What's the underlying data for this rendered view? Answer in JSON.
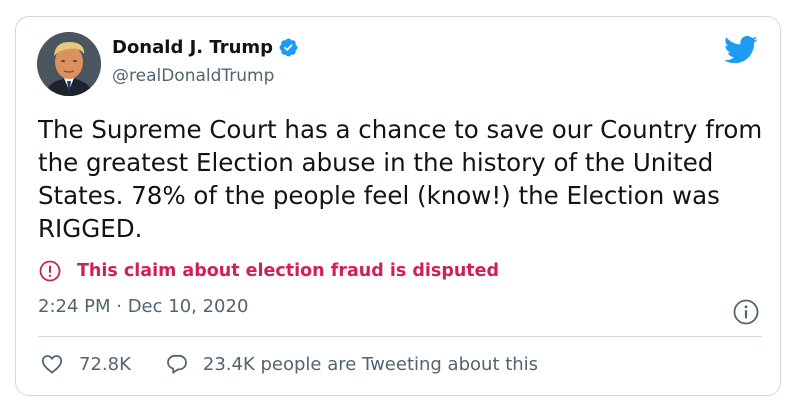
{
  "author": {
    "display_name": "Donald J. Trump",
    "handle": "@realDonaldTrump",
    "verified": true
  },
  "tweet": {
    "text": "The Supreme Court has a chance to save our Country from the greatest Election abuse in the history of the United States. 78% of the people feel (know!) the Election was RIGGED.",
    "disputed_label": "This claim about election fraud is disputed",
    "timestamp": "2:24 PM · Dec 10, 2020"
  },
  "stats": {
    "likes": "72.8K",
    "tweeting_about": "23.4K people are Tweeting about this"
  },
  "colors": {
    "twitter_blue": "#1d9bf0",
    "disputed_red": "#d01f5b",
    "secondary_text": "#536471",
    "border": "#cfd9de"
  },
  "icons": {
    "verified": "verified-badge-icon",
    "logo": "twitter-bird-icon",
    "disputed": "exclamation-circle-icon",
    "info": "info-circle-icon",
    "like": "heart-outline-icon",
    "reply": "speech-bubble-icon"
  }
}
